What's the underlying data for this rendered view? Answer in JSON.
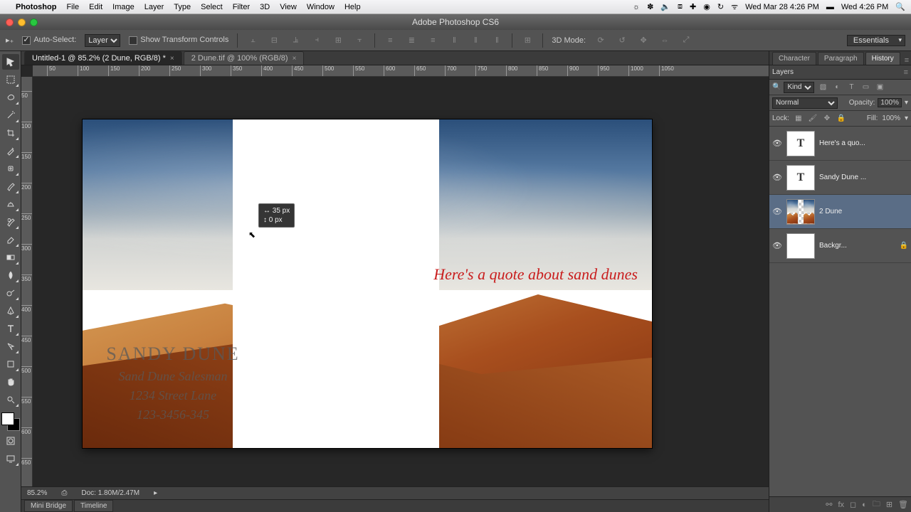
{
  "mac": {
    "app_name": "Photoshop",
    "menus": [
      "File",
      "Edit",
      "Image",
      "Layer",
      "Type",
      "Select",
      "Filter",
      "3D",
      "View",
      "Window",
      "Help"
    ],
    "date_full": "Wed Mar 28  4:26 PM",
    "date_short": "Wed 4:26 PM"
  },
  "titlebar": {
    "title": "Adobe Photoshop CS6"
  },
  "options": {
    "auto_select_label": "Auto-Select:",
    "auto_select_value": "Layer",
    "show_transform_label": "Show Transform Controls",
    "mode3d_label": "3D Mode:",
    "workspace": "Essentials"
  },
  "tabs": [
    {
      "label": "Untitled-1 @ 85.2% (2 Dune, RGB/8) *",
      "active": true
    },
    {
      "label": "2 Dune.tif @ 100% (RGB/8)",
      "active": false
    }
  ],
  "ruler_marks": [
    "50",
    "100",
    "150",
    "200",
    "250",
    "300",
    "350",
    "400",
    "450",
    "500",
    "550",
    "600",
    "650",
    "700",
    "750",
    "800",
    "850",
    "900",
    "950",
    "1000",
    "1050"
  ],
  "ruler_v": [
    "50",
    "100",
    "150",
    "200",
    "250",
    "300",
    "350",
    "400",
    "450",
    "500",
    "550",
    "600",
    "650"
  ],
  "canvas": {
    "name": "SANDY DUNE",
    "title": "Sand Dune Salesman",
    "address": "1234 Street Lane",
    "phone": "123-3456-345",
    "quote": "Here's a quote about sand dunes",
    "tooltip_dx_label": "↔",
    "tooltip_dx": "35 px",
    "tooltip_dy_label": "↕",
    "tooltip_dy": "0 px"
  },
  "status": {
    "zoom": "85.2%",
    "doc_size": "Doc: 1.80M/2.47M"
  },
  "bottom_tabs": [
    "Mini Bridge",
    "Timeline"
  ],
  "panels": {
    "top_tabs": [
      "Character",
      "Paragraph",
      "History"
    ],
    "layers_label": "Layers",
    "filter_label": "Kind",
    "blend_mode": "Normal",
    "opacity_label": "Opacity:",
    "opacity_value": "100%",
    "lock_label": "Lock:",
    "fill_label": "Fill:",
    "fill_value": "100%",
    "layers": [
      {
        "name": "Here's a quo...",
        "type": "text",
        "selected": false,
        "locked": false
      },
      {
        "name": "Sandy Dune ...",
        "type": "text",
        "selected": false,
        "locked": false
      },
      {
        "name": "2 Dune",
        "type": "image",
        "selected": true,
        "locked": false
      },
      {
        "name": "Backgr...",
        "type": "solid",
        "selected": false,
        "locked": true
      }
    ]
  }
}
